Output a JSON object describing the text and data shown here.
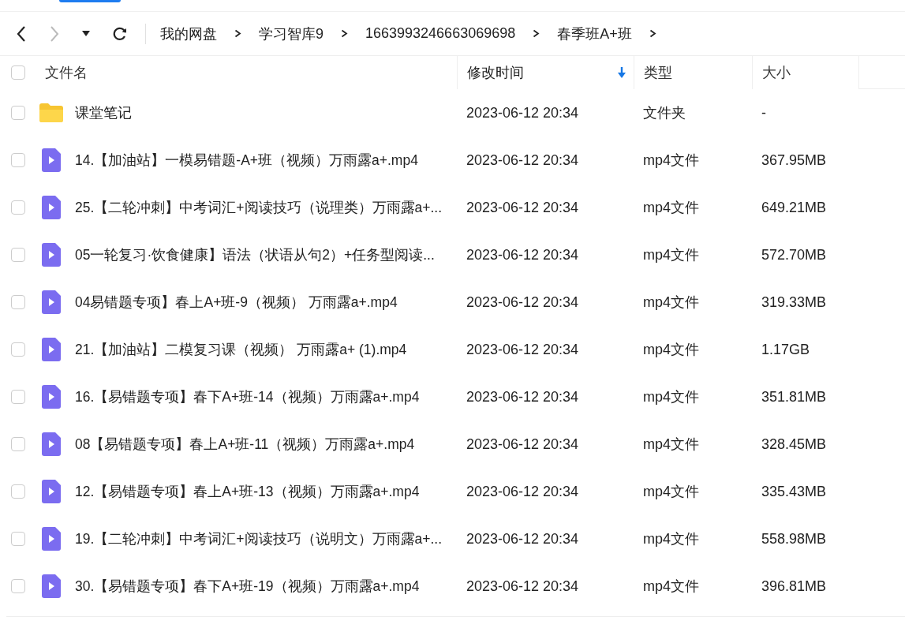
{
  "breadcrumb": [
    "我的网盘",
    "学习智库9",
    "1663993246663069698",
    "春季班A+班"
  ],
  "header": {
    "select_all_checked": false,
    "columns": [
      {
        "label": "文件名",
        "sorted": false
      },
      {
        "label": "修改时间",
        "sorted": true
      },
      {
        "label": "类型",
        "sorted": false
      },
      {
        "label": "大小",
        "sorted": false
      }
    ]
  },
  "files": [
    {
      "kind": "folder",
      "checked": false,
      "name": "课堂笔记",
      "modified": "2023-06-12 20:34",
      "type": "文件夹",
      "size": "-"
    },
    {
      "kind": "video",
      "checked": false,
      "name": "14.【加油站】一模易错题-A+班（视频）万雨露a+.mp4",
      "modified": "2023-06-12 20:34",
      "type": "mp4文件",
      "size": "367.95MB"
    },
    {
      "kind": "video",
      "checked": false,
      "name": "25.【二轮冲刺】中考词汇+阅读技巧（说理类）万雨露a+...",
      "modified": "2023-06-12 20:34",
      "type": "mp4文件",
      "size": "649.21MB"
    },
    {
      "kind": "video",
      "checked": false,
      "name": "05一轮复习·饮食健康】语法（状语从句2）+任务型阅读...",
      "modified": "2023-06-12 20:34",
      "type": "mp4文件",
      "size": "572.70MB"
    },
    {
      "kind": "video",
      "checked": false,
      "name": "04易错题专项】春上A+班-9（视频） 万雨露a+.mp4",
      "modified": "2023-06-12 20:34",
      "type": "mp4文件",
      "size": "319.33MB"
    },
    {
      "kind": "video",
      "checked": false,
      "name": "21.【加油站】二模复习课（视频）  万雨露a+ (1).mp4",
      "modified": "2023-06-12 20:34",
      "type": "mp4文件",
      "size": "1.17GB"
    },
    {
      "kind": "video",
      "checked": false,
      "name": "16.【易错题专项】春下A+班-14（视频）万雨露a+.mp4",
      "modified": "2023-06-12 20:34",
      "type": "mp4文件",
      "size": "351.81MB"
    },
    {
      "kind": "video",
      "checked": false,
      "name": "08【易错题专项】春上A+班-11（视频）万雨露a+.mp4",
      "modified": "2023-06-12 20:34",
      "type": "mp4文件",
      "size": "328.45MB"
    },
    {
      "kind": "video",
      "checked": false,
      "name": "12.【易错题专项】春上A+班-13（视频）万雨露a+.mp4",
      "modified": "2023-06-12 20:34",
      "type": "mp4文件",
      "size": "335.43MB"
    },
    {
      "kind": "video",
      "checked": false,
      "name": "19.【二轮冲刺】中考词汇+阅读技巧（说明文）万雨露a+...",
      "modified": "2023-06-12 20:34",
      "type": "mp4文件",
      "size": "558.98MB"
    },
    {
      "kind": "video",
      "checked": false,
      "name": "30.【易错题专项】春下A+班-19（视频）万雨露a+.mp4",
      "modified": "2023-06-12 20:34",
      "type": "mp4文件",
      "size": "396.81MB"
    }
  ]
}
